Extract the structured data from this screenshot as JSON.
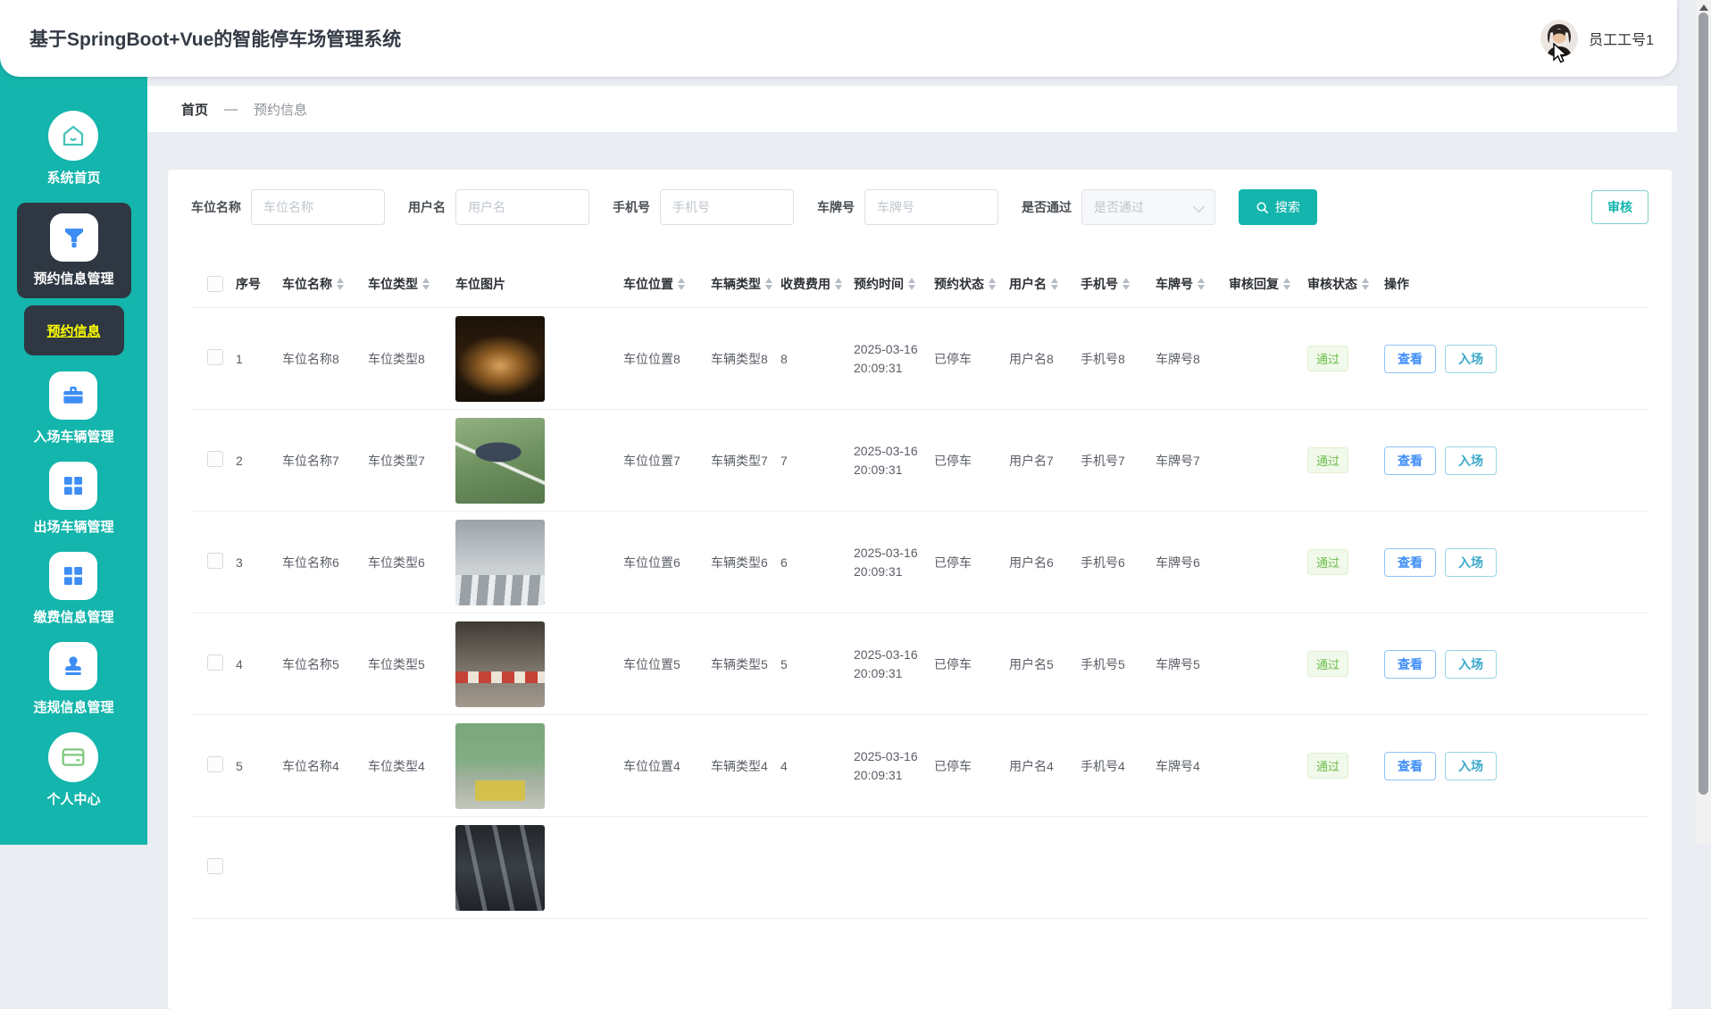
{
  "app": {
    "title": "基于SpringBoot+Vue的智能停车场管理系统",
    "user": "员工工号1"
  },
  "colors": {
    "sidebar_teal": "#13b5ac",
    "menu_active_bg": "#2e3742",
    "menu_active_text": "#ffff00",
    "icon_blue": "#3d8df5",
    "tag_pass_green": "#6cbd4a",
    "button_view_blue": "#3e8ef7",
    "button_enter_teal": "#3ba9cb"
  },
  "sidebar": {
    "items": [
      {
        "name": "home",
        "label": "系统首页",
        "icon": "home-icon",
        "shape": "circle"
      },
      {
        "name": "reservation-management",
        "label": "预约信息管理",
        "icon": "filter-icon",
        "shape": "square",
        "active": true,
        "sub": {
          "name": "reservation-info",
          "label": "预约信息"
        }
      },
      {
        "name": "entry-vehicle-management",
        "label": "入场车辆管理",
        "icon": "toolbox-icon",
        "shape": "square"
      },
      {
        "name": "exit-vehicle-management",
        "label": "出场车辆管理",
        "icon": "grid-icon",
        "shape": "square"
      },
      {
        "name": "payment-management",
        "label": "缴费信息管理",
        "icon": "grid-icon",
        "shape": "square"
      },
      {
        "name": "violation-management",
        "label": "违规信息管理",
        "icon": "stamp-icon",
        "shape": "square"
      },
      {
        "name": "personal-center",
        "label": "个人中心",
        "icon": "bank-card-icon",
        "shape": "circle"
      }
    ]
  },
  "breadcrumb": {
    "home": "首页",
    "sep": "—",
    "current": "预约信息"
  },
  "toolbar": {
    "filters": [
      {
        "key": "space_name",
        "label": "车位名称",
        "placeholder": "车位名称",
        "type": "input"
      },
      {
        "key": "user",
        "label": "用户名",
        "placeholder": "用户名",
        "type": "input"
      },
      {
        "key": "phone",
        "label": "手机号",
        "placeholder": "手机号",
        "type": "input"
      },
      {
        "key": "plate",
        "label": "车牌号",
        "placeholder": "车牌号",
        "type": "input"
      },
      {
        "key": "pass",
        "label": "是否通过",
        "placeholder": "是否通过",
        "type": "select"
      }
    ],
    "search_label": "搜索",
    "audit_label": "审核"
  },
  "table": {
    "columns": [
      {
        "key": "no",
        "label": "序号",
        "sortable": false
      },
      {
        "key": "space_name",
        "label": "车位名称",
        "sortable": true
      },
      {
        "key": "space_type",
        "label": "车位类型",
        "sortable": true
      },
      {
        "key": "image",
        "label": "车位图片",
        "sortable": false
      },
      {
        "key": "location",
        "label": "车位位置",
        "sortable": true
      },
      {
        "key": "vehicle_type",
        "label": "车辆类型",
        "sortable": true
      },
      {
        "key": "fee",
        "label": "收费费用",
        "sortable": true
      },
      {
        "key": "time",
        "label": "预约时间",
        "sortable": true
      },
      {
        "key": "status",
        "label": "预约状态",
        "sortable": true
      },
      {
        "key": "user",
        "label": "用户名",
        "sortable": true
      },
      {
        "key": "phone",
        "label": "手机号",
        "sortable": true
      },
      {
        "key": "plate",
        "label": "车牌号",
        "sortable": true
      },
      {
        "key": "reply",
        "label": "审核回复",
        "sortable": true
      },
      {
        "key": "audit",
        "label": "审核状态",
        "sortable": true
      },
      {
        "key": "actions",
        "label": "操作",
        "sortable": false
      }
    ],
    "action_labels": [
      "查看",
      "入场"
    ],
    "rows": [
      {
        "no": "1",
        "space_name": "车位名称8",
        "space_type": "车位类型8",
        "photo": "underground-garage-aisle",
        "location": "车位位置8",
        "vehicle_type": "车辆类型8",
        "fee": "8",
        "date": "2025-03-16",
        "clock": "20:09:31",
        "status": "已停车",
        "user": "用户名8",
        "phone": "手机号8",
        "plate": "车牌号8",
        "reply": "",
        "audit": "通过"
      },
      {
        "no": "2",
        "space_name": "车位名称7",
        "space_type": "车位类型7",
        "photo": "green-floor-garage",
        "location": "车位位置7",
        "vehicle_type": "车辆类型7",
        "fee": "7",
        "date": "2025-03-16",
        "clock": "20:09:31",
        "status": "已停车",
        "user": "用户名7",
        "phone": "手机号7",
        "plate": "车牌号7",
        "reply": "",
        "audit": "通过"
      },
      {
        "no": "3",
        "space_name": "车位名称6",
        "space_type": "车位类型6",
        "photo": "street-parking",
        "location": "车位位置6",
        "vehicle_type": "车辆类型6",
        "fee": "6",
        "date": "2025-03-16",
        "clock": "20:09:31",
        "status": "已停车",
        "user": "用户名6",
        "phone": "手机号6",
        "plate": "车牌号6",
        "reply": "",
        "audit": "通过"
      },
      {
        "no": "4",
        "space_name": "车位名称5",
        "space_type": "车位类型5",
        "photo": "garage-red-barrier",
        "location": "车位位置5",
        "vehicle_type": "车辆类型5",
        "fee": "5",
        "date": "2025-03-16",
        "clock": "20:09:31",
        "status": "已停车",
        "user": "用户名5",
        "phone": "手机号5",
        "plate": "车牌号5",
        "reply": "",
        "audit": "通过"
      },
      {
        "no": "5",
        "space_name": "车位名称4",
        "space_type": "车位类型4",
        "photo": "green-wall-garage",
        "location": "车位位置4",
        "vehicle_type": "车辆类型4",
        "fee": "4",
        "date": "2025-03-16",
        "clock": "20:09:31",
        "status": "已停车",
        "user": "用户名4",
        "phone": "手机号4",
        "plate": "车牌号4",
        "reply": "",
        "audit": "通过"
      },
      {
        "partial": true,
        "no": "",
        "space_name": "",
        "space_type": "",
        "photo": "garage-ceiling",
        "location": "",
        "vehicle_type": "",
        "fee": "",
        "date": "",
        "clock": "",
        "status": "",
        "user": "",
        "phone": "",
        "plate": "",
        "reply": "",
        "audit": ""
      }
    ]
  }
}
